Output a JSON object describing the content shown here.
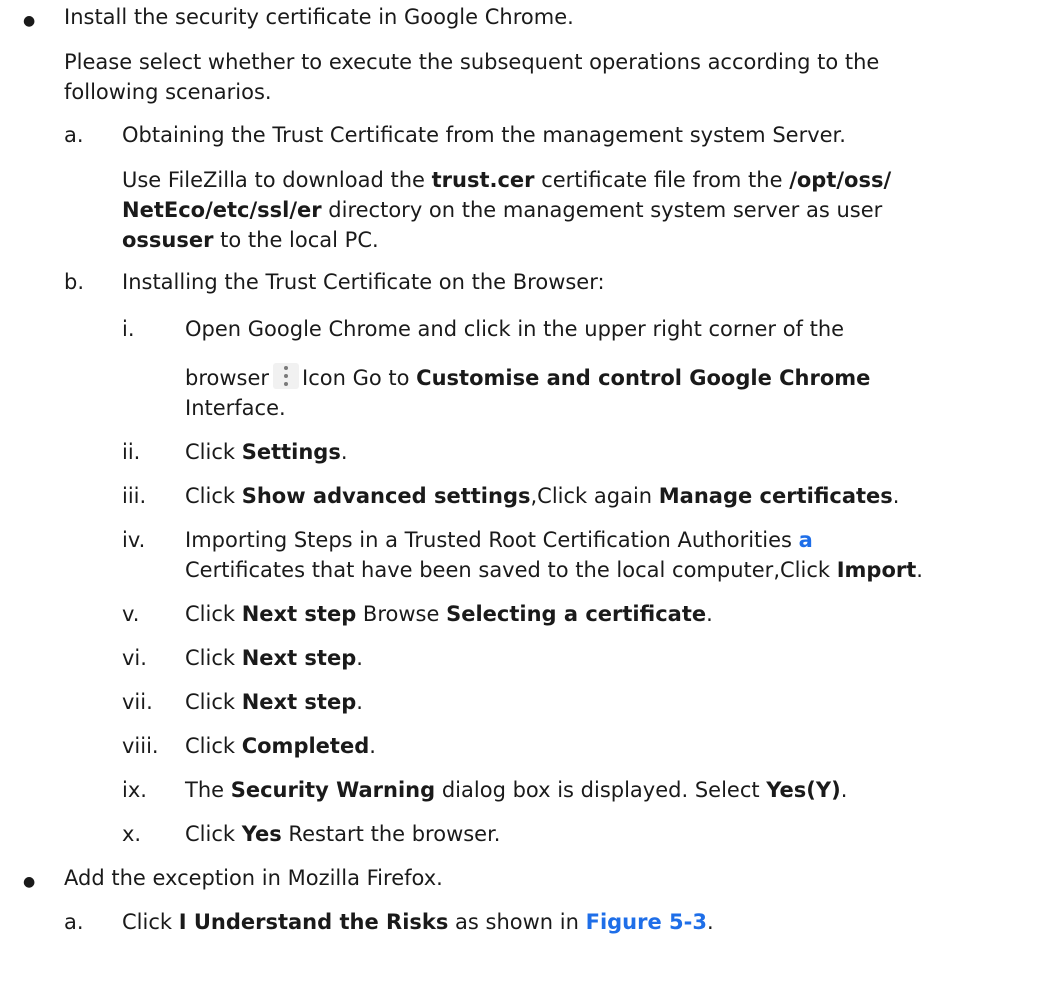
{
  "bullets": [
    {
      "title": "Install the security certificate in Google Chrome.",
      "intro_l1": "Please select whether to execute the subsequent operations according to the",
      "intro_l2": "following scenarios.",
      "step_a": {
        "marker": "a.",
        "title": "Obtaining the Trust Certificate from the management system Server.",
        "l1_pre": "Use FileZilla to download the ",
        "file": "trust.cer",
        "l1_mid": " certificate file from the ",
        "dir1": "/opt/oss/",
        "dir2": "NetEco/etc/ssl/er",
        "l2_post": " directory on the management system server as user",
        "user": "ossuser",
        "l3_post": " to the local PC."
      },
      "step_b": {
        "marker": "b.",
        "title": "Installing the Trust Certificate on the Browser:",
        "substeps": {
          "i": {
            "marker": "i.",
            "l1": "Open Google Chrome and click in the upper right corner of the",
            "l2_pre": "browser",
            "l2_mid": "Icon Go to ",
            "l2_bold": "Customise and control Google Chrome",
            "l3": "Interface.",
            "icon": "more-vert-icon"
          },
          "ii": {
            "marker": "ii.",
            "pre": "Click ",
            "bold": "Settings",
            "post": "."
          },
          "iii": {
            "marker": "iii.",
            "pre": "Click ",
            "bold1": "Show advanced settings",
            "mid": ",Click again ",
            "bold2": "Manage certificates",
            "post": "."
          },
          "iv": {
            "marker": "iv.",
            "l1_pre": "Importing Steps in a Trusted Root Certification Authorities ",
            "link": "a",
            "l2_pre": "Certificates that have been saved to the local computer,Click ",
            "l2_bold": "Import",
            "l2_post": "."
          },
          "v": {
            "marker": "v.",
            "pre": "Click ",
            "bold1": "Next step",
            "mid": " Browse ",
            "bold2": "Selecting a certificate",
            "post": "."
          },
          "vi": {
            "marker": "vi.",
            "pre": "Click ",
            "bold": "Next step",
            "post": "."
          },
          "vii": {
            "marker": "vii.",
            "pre": "Click ",
            "bold": "Next step",
            "post": "."
          },
          "viii": {
            "marker": "viii.",
            "pre": "Click ",
            "bold": "Completed",
            "post": "."
          },
          "ix": {
            "marker": "ix.",
            "pre": "The ",
            "bold1": "Security Warning",
            "mid": " dialog box is displayed. Select ",
            "bold2": "Yes(Y)",
            "post": "."
          },
          "x": {
            "marker": "x.",
            "pre": "Click ",
            "bold": "Yes",
            "post": " Restart the browser."
          }
        }
      }
    },
    {
      "title": "Add the exception in Mozilla Firefox.",
      "step_a": {
        "marker": "a.",
        "pre": "Click ",
        "bold": "I Understand the Risks",
        "mid": " as shown in ",
        "link": "Figure 5-3",
        "post": "."
      }
    }
  ],
  "bullet_char": "●"
}
